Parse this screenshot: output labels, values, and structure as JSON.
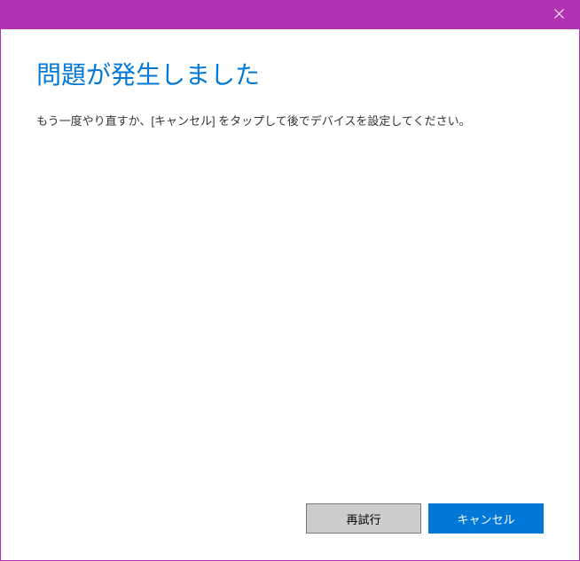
{
  "dialog": {
    "heading": "問題が発生しました",
    "message": "もう一度やり直すか、[キャンセル] をタップして後でデバイスを設定してください。",
    "buttons": {
      "retry": "再試行",
      "cancel": "キャンセル"
    }
  }
}
